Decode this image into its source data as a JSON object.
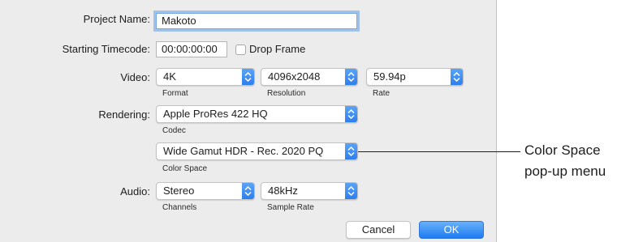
{
  "project_name": {
    "label": "Project Name:",
    "value": "Makoto"
  },
  "timecode": {
    "label": "Starting Timecode:",
    "value": "00:00:00:00",
    "drop_frame_label": "Drop Frame",
    "drop_frame_checked": false
  },
  "video": {
    "label": "Video:",
    "format": {
      "value": "4K",
      "caption": "Format"
    },
    "resolution": {
      "value": "4096x2048",
      "caption": "Resolution"
    },
    "rate": {
      "value": "59.94p",
      "caption": "Rate"
    }
  },
  "rendering": {
    "label": "Rendering:",
    "codec": {
      "value": "Apple ProRes 422 HQ",
      "caption": "Codec"
    },
    "color_space": {
      "value": "Wide Gamut HDR - Rec. 2020 PQ",
      "caption": "Color Space"
    }
  },
  "audio": {
    "label": "Audio:",
    "channels": {
      "value": "Stereo",
      "caption": "Channels"
    },
    "sample_rate": {
      "value": "48kHz",
      "caption": "Sample Rate"
    }
  },
  "buttons": {
    "cancel": "Cancel",
    "ok": "OK"
  },
  "callout": {
    "line1": "Color Space",
    "line2": "pop-up menu"
  },
  "colors": {
    "accent": "#2d7ef0",
    "dialog_bg": "#ececec"
  },
  "icons": {
    "popup_arrow": "chevron-updown-icon"
  }
}
